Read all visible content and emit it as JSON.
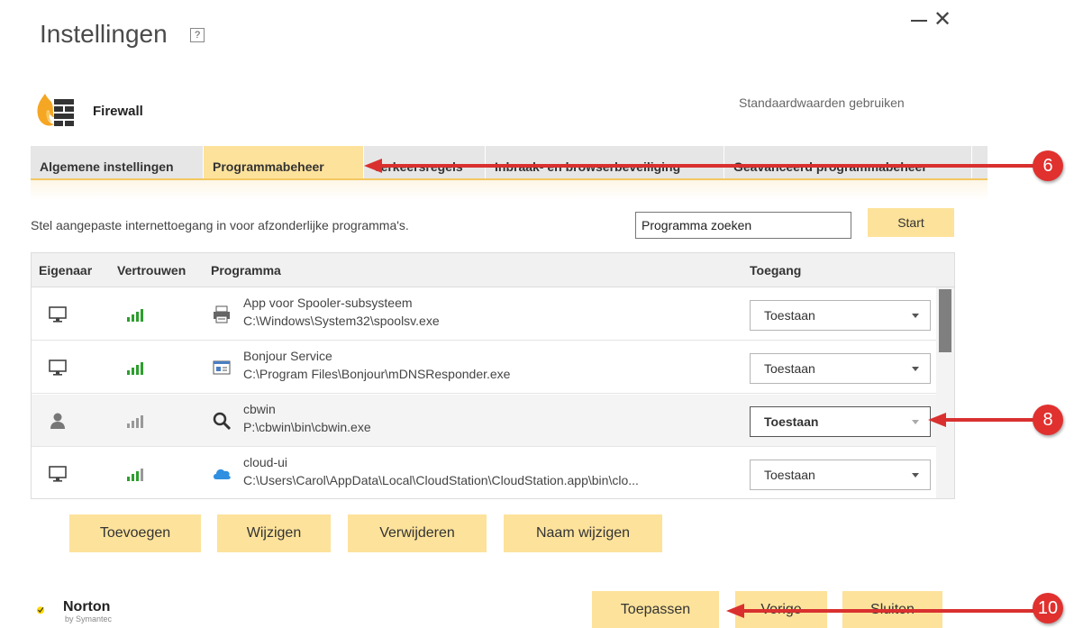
{
  "window": {
    "title": "Instellingen",
    "help": "?",
    "minimize": "—",
    "close": "✕"
  },
  "section": {
    "title": "Firewall",
    "defaults_link": "Standaardwaarden gebruiken"
  },
  "tabs": [
    {
      "label": "Algemene instellingen",
      "active": false
    },
    {
      "label": "Programmabeheer",
      "active": true
    },
    {
      "label": "Verkeersregels",
      "active": false
    },
    {
      "label": "Inbraak- en browserbeveiliging",
      "active": false
    },
    {
      "label": "Geavanceerd programmabeheer",
      "active": false
    }
  ],
  "description": "Stel aangepaste internettoegang in voor afzonderlijke programma's.",
  "search": {
    "value": "Programma zoeken",
    "button": "Start"
  },
  "table": {
    "headers": {
      "owner": "Eigenaar",
      "trust": "Vertrouwen",
      "program": "Programma",
      "access": "Toegang"
    },
    "rows": [
      {
        "owner_icon": "computer-icon",
        "trust_icon": "trust-high-icon",
        "program_icon": "printer-icon",
        "name": "App voor Spooler-subsysteem",
        "path": "C:\\Windows\\System32\\spoolsv.exe",
        "access": "Toestaan"
      },
      {
        "owner_icon": "computer-icon",
        "trust_icon": "trust-high-icon",
        "program_icon": "service-icon",
        "name": "Bonjour Service",
        "path": "C:\\Program Files\\Bonjour\\mDNSResponder.exe",
        "access": "Toestaan"
      },
      {
        "owner_icon": "user-icon",
        "trust_icon": "trust-unknown-icon",
        "program_icon": "search-icon",
        "name": "cbwin",
        "path": "P:\\cbwin\\bin\\cbwin.exe",
        "access": "Toestaan"
      },
      {
        "owner_icon": "computer-icon",
        "trust_icon": "trust-medium-icon",
        "program_icon": "cloud-icon",
        "name": "cloud-ui",
        "path": "C:\\Users\\Carol\\AppData\\Local\\CloudStation\\CloudStation.app\\bin\\clo...",
        "access": "Toestaan"
      }
    ]
  },
  "actions": {
    "add": "Toevoegen",
    "modify": "Wijzigen",
    "remove": "Verwijderen",
    "rename": "Naam wijzigen"
  },
  "footer": {
    "brand": "Norton",
    "brand_sub": "by Symantec",
    "apply": "Toepassen",
    "back": "Vorige",
    "close": "Sluiten"
  },
  "annotations": [
    "6",
    "8",
    "10"
  ],
  "colors": {
    "accent": "#fde29b",
    "annotation": "#e0312f",
    "trust_green": "#2e9e2e"
  }
}
